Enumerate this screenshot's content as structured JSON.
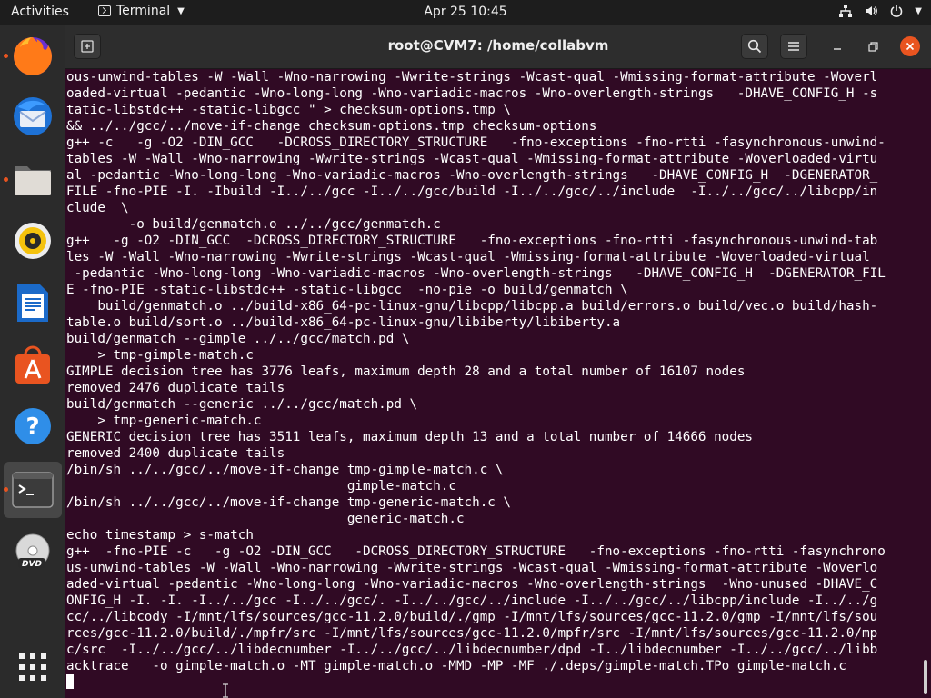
{
  "topbar": {
    "activities": "Activities",
    "app_name": "Terminal",
    "datetime": "Apr 25  10:45"
  },
  "dock": {
    "items": [
      {
        "name": "firefox",
        "icon": "firefox-icon",
        "running": true
      },
      {
        "name": "thunderbird",
        "icon": "thunderbird-icon",
        "running": false
      },
      {
        "name": "files",
        "icon": "files-icon",
        "running": true
      },
      {
        "name": "rhythmbox",
        "icon": "rhythmbox-icon",
        "running": false
      },
      {
        "name": "libreoffice-writer",
        "icon": "writer-icon",
        "running": false
      },
      {
        "name": "ubuntu-software",
        "icon": "software-icon",
        "running": false
      },
      {
        "name": "help",
        "icon": "help-icon",
        "running": false
      },
      {
        "name": "terminal",
        "icon": "terminal-icon",
        "running": true,
        "active": true
      },
      {
        "name": "dvd",
        "icon": "dvd-icon",
        "running": false
      },
      {
        "name": "show-applications",
        "icon": "app-grid-icon",
        "running": false
      }
    ]
  },
  "window": {
    "title": "root@CVM7: /home/collabvm"
  },
  "colors": {
    "terminal_bg": "#300a24",
    "accent": "#e95420",
    "text": "#ffffff"
  },
  "terminal": {
    "lines": [
      "ous-unwind-tables -W -Wall -Wno-narrowing -Wwrite-strings -Wcast-qual -Wmissing-format-attribute -Woverl",
      "oaded-virtual -pedantic -Wno-long-long -Wno-variadic-macros -Wno-overlength-strings   -DHAVE_CONFIG_H -s",
      "tatic-libstdc++ -static-libgcc \" > checksum-options.tmp \\",
      "&& ../../gcc/../move-if-change checksum-options.tmp checksum-options",
      "g++ -c   -g -O2 -DIN_GCC   -DCROSS_DIRECTORY_STRUCTURE   -fno-exceptions -fno-rtti -fasynchronous-unwind-",
      "tables -W -Wall -Wno-narrowing -Wwrite-strings -Wcast-qual -Wmissing-format-attribute -Woverloaded-virtu",
      "al -pedantic -Wno-long-long -Wno-variadic-macros -Wno-overlength-strings   -DHAVE_CONFIG_H  -DGENERATOR_",
      "FILE -fno-PIE -I. -Ibuild -I../../gcc -I../../gcc/build -I../../gcc/../include  -I../../gcc/../libcpp/in",
      "clude  \\",
      "        -o build/genmatch.o ../../gcc/genmatch.c",
      "g++   -g -O2 -DIN_GCC  -DCROSS_DIRECTORY_STRUCTURE   -fno-exceptions -fno-rtti -fasynchronous-unwind-tab",
      "les -W -Wall -Wno-narrowing -Wwrite-strings -Wcast-qual -Wmissing-format-attribute -Woverloaded-virtual",
      " -pedantic -Wno-long-long -Wno-variadic-macros -Wno-overlength-strings   -DHAVE_CONFIG_H  -DGENERATOR_FIL",
      "E -fno-PIE -static-libstdc++ -static-libgcc  -no-pie -o build/genmatch \\",
      "    build/genmatch.o ../build-x86_64-pc-linux-gnu/libcpp/libcpp.a build/errors.o build/vec.o build/hash-",
      "table.o build/sort.o ../build-x86_64-pc-linux-gnu/libiberty/libiberty.a",
      "build/genmatch --gimple ../../gcc/match.pd \\",
      "    > tmp-gimple-match.c",
      "GIMPLE decision tree has 3776 leafs, maximum depth 28 and a total number of 16107 nodes",
      "removed 2476 duplicate tails",
      "build/genmatch --generic ../../gcc/match.pd \\",
      "    > tmp-generic-match.c",
      "GENERIC decision tree has 3511 leafs, maximum depth 13 and a total number of 14666 nodes",
      "removed 2400 duplicate tails",
      "/bin/sh ../../gcc/../move-if-change tmp-gimple-match.c \\",
      "                                    gimple-match.c",
      "/bin/sh ../../gcc/../move-if-change tmp-generic-match.c \\",
      "                                    generic-match.c",
      "echo timestamp > s-match",
      "g++  -fno-PIE -c   -g -O2 -DIN_GCC   -DCROSS_DIRECTORY_STRUCTURE   -fno-exceptions -fno-rtti -fasynchrono",
      "us-unwind-tables -W -Wall -Wno-narrowing -Wwrite-strings -Wcast-qual -Wmissing-format-attribute -Woverlo",
      "aded-virtual -pedantic -Wno-long-long -Wno-variadic-macros -Wno-overlength-strings  -Wno-unused -DHAVE_C",
      "ONFIG_H -I. -I. -I../../gcc -I../../gcc/. -I../../gcc/../include -I../../gcc/../libcpp/include -I../../g",
      "cc/../libcody -I/mnt/lfs/sources/gcc-11.2.0/build/./gmp -I/mnt/lfs/sources/gcc-11.2.0/gmp -I/mnt/lfs/sou",
      "rces/gcc-11.2.0/build/./mpfr/src -I/mnt/lfs/sources/gcc-11.2.0/mpfr/src -I/mnt/lfs/sources/gcc-11.2.0/mp",
      "c/src  -I../../gcc/../libdecnumber -I../../gcc/../libdecnumber/dpd -I../libdecnumber -I../../gcc/../libb",
      "acktrace   -o gimple-match.o -MT gimple-match.o -MMD -MP -MF ./.deps/gimple-match.TPo gimple-match.c"
    ]
  }
}
